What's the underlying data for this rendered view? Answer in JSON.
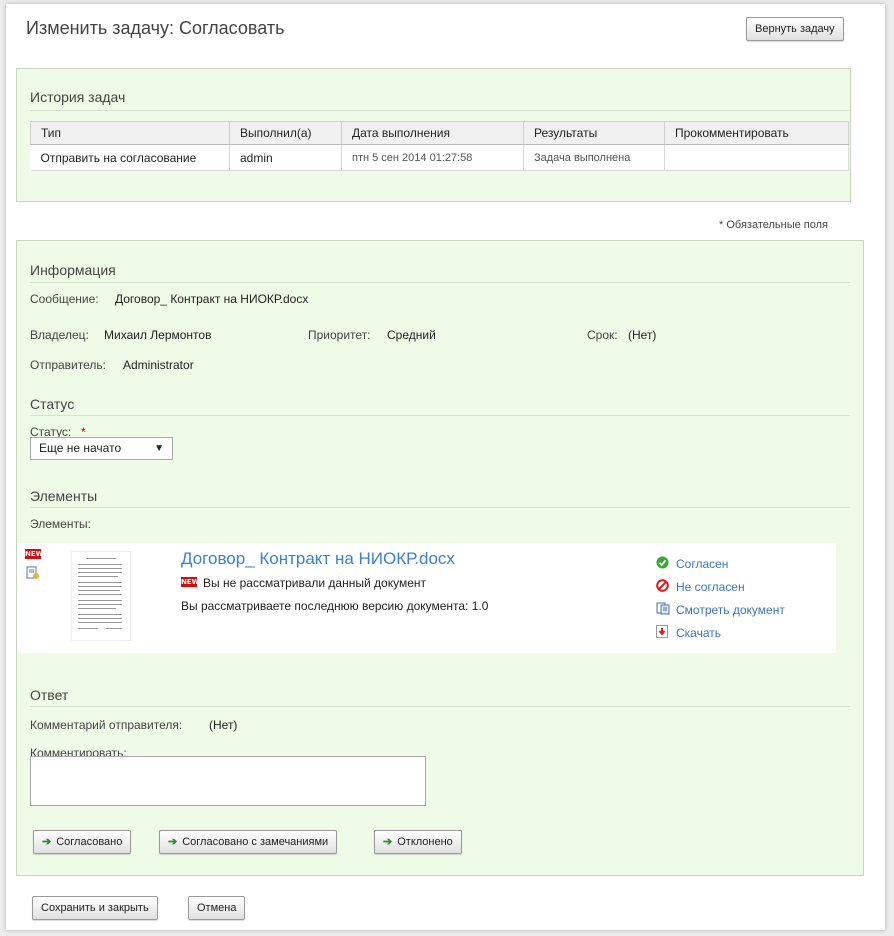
{
  "header": {
    "title": "Изменить задачу: Согласовать",
    "return_button": "Вернуть задачу"
  },
  "history": {
    "heading": "История задач",
    "columns": [
      "Тип",
      "Выполнил(а)",
      "Дата выполнения",
      "Результаты",
      "Прокомментировать"
    ],
    "rows": [
      [
        "Отправить на согласование",
        "admin",
        "птн 5 сен 2014 01:27:58",
        "Задача выполнена",
        ""
      ]
    ]
  },
  "required_note": "* Обязательные поля",
  "info": {
    "heading": "Информация",
    "message_label": "Сообщение:",
    "message_value": "Договор_ Контракт на НИОКР.docx",
    "owner_label": "Владелец:",
    "owner_value": "Михаил Лермонтов",
    "priority_label": "Приоритет:",
    "priority_value": "Средний",
    "due_label": "Срок:",
    "due_value": "(Нет)",
    "sender_label": "Отправитель:",
    "sender_value": "Administrator"
  },
  "status": {
    "heading": "Статус",
    "label": "Статус:",
    "required_mark": "*",
    "selected": "Еще не начато"
  },
  "elements": {
    "heading": "Элементы",
    "label": "Элементы:",
    "doc": {
      "name": "Договор_ Контракт на НИОКР.docx",
      "not_viewed": "Вы не рассматривали данный документ",
      "version_note": "Вы рассматриваете последнюю версию документа: 1.0",
      "badge": "NEW",
      "actions": [
        "Согласен",
        "Не согласен",
        "Смотреть документ",
        "Скачать"
      ]
    }
  },
  "answer": {
    "heading": "Ответ",
    "sender_comment_label": "Комментарий отправителя:",
    "sender_comment_value": "(Нет)",
    "comment_label": "Комментировать:",
    "comment_value": "",
    "buttons": [
      "Согласовано",
      "Согласовано с замечаниями",
      "Отклонено"
    ]
  },
  "footer": {
    "save_close": "Сохранить и закрыть",
    "cancel": "Отмена"
  },
  "colors": {
    "panel_bg": "#eefbe6",
    "link": "#3c82c6",
    "accept": "#3aa637",
    "reject": "#d42020",
    "new_badge": "#cc1111"
  }
}
